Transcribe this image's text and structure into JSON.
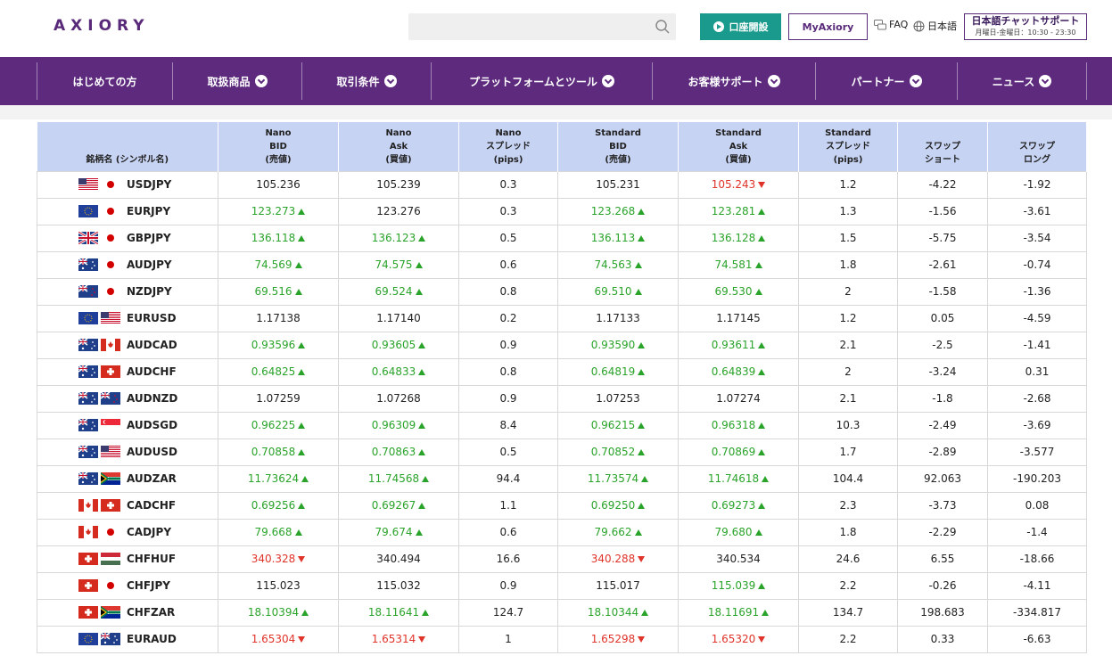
{
  "header": {
    "logo": "AXIORY",
    "search_placeholder": "",
    "open_account_label": "口座開設",
    "myaxiory_label": "MyAxiory",
    "faq_label": "FAQ",
    "language_label": "日本語",
    "chat_title": "日本語チャットサポート",
    "chat_hours": "月曜日-金曜日：10:30 - 23:30"
  },
  "nav": [
    {
      "label": "はじめての方",
      "dropdown": false
    },
    {
      "label": "取扱商品",
      "dropdown": true
    },
    {
      "label": "取引条件",
      "dropdown": true
    },
    {
      "label": "プラットフォームとツール",
      "dropdown": true
    },
    {
      "label": "お客様サポート",
      "dropdown": true
    },
    {
      "label": "パートナー",
      "dropdown": true
    },
    {
      "label": "ニュース",
      "dropdown": true
    }
  ],
  "table": {
    "headers": [
      [
        "銘柄名 (シンボル名)"
      ],
      [
        "Nano",
        "BID",
        "(売値)"
      ],
      [
        "Nano",
        "Ask",
        "(買値)"
      ],
      [
        "Nano",
        "スプレッド",
        "(pips)"
      ],
      [
        "Standard",
        "BID",
        "(売値)"
      ],
      [
        "Standard",
        "Ask",
        "(買値)"
      ],
      [
        "Standard",
        "スプレッド",
        "(pips)"
      ],
      [
        "スワップ",
        "ショート"
      ],
      [
        "スワップ",
        "ロング"
      ]
    ],
    "colors": {
      "up": "#2aa32a",
      "down": "#e0332a"
    },
    "rows": [
      {
        "symbol": "USDJPY",
        "flags": [
          "us",
          "jp"
        ],
        "nbid": "105.236",
        "nbid_dir": "",
        "nask": "105.239",
        "nask_dir": "",
        "nsp": "0.3",
        "sbid": "105.231",
        "sbid_dir": "",
        "sask": "105.243",
        "sask_dir": "down",
        "ssp": "1.2",
        "short": "-4.22",
        "long": "-1.92"
      },
      {
        "symbol": "EURJPY",
        "flags": [
          "eu",
          "jp"
        ],
        "nbid": "123.273",
        "nbid_dir": "up",
        "nask": "123.276",
        "nask_dir": "",
        "nsp": "0.3",
        "sbid": "123.268",
        "sbid_dir": "up",
        "sask": "123.281",
        "sask_dir": "up",
        "ssp": "1.3",
        "short": "-1.56",
        "long": "-3.61"
      },
      {
        "symbol": "GBPJPY",
        "flags": [
          "gb",
          "jp"
        ],
        "nbid": "136.118",
        "nbid_dir": "up",
        "nask": "136.123",
        "nask_dir": "up",
        "nsp": "0.5",
        "sbid": "136.113",
        "sbid_dir": "up",
        "sask": "136.128",
        "sask_dir": "up",
        "ssp": "1.5",
        "short": "-5.75",
        "long": "-3.54"
      },
      {
        "symbol": "AUDJPY",
        "flags": [
          "au",
          "jp"
        ],
        "nbid": "74.569",
        "nbid_dir": "up",
        "nask": "74.575",
        "nask_dir": "up",
        "nsp": "0.6",
        "sbid": "74.563",
        "sbid_dir": "up",
        "sask": "74.581",
        "sask_dir": "up",
        "ssp": "1.8",
        "short": "-2.61",
        "long": "-0.74"
      },
      {
        "symbol": "NZDJPY",
        "flags": [
          "nz",
          "jp"
        ],
        "nbid": "69.516",
        "nbid_dir": "up",
        "nask": "69.524",
        "nask_dir": "up",
        "nsp": "0.8",
        "sbid": "69.510",
        "sbid_dir": "up",
        "sask": "69.530",
        "sask_dir": "up",
        "ssp": "2",
        "short": "-1.58",
        "long": "-1.36"
      },
      {
        "symbol": "EURUSD",
        "flags": [
          "eu",
          "us"
        ],
        "nbid": "1.17138",
        "nbid_dir": "",
        "nask": "1.17140",
        "nask_dir": "",
        "nsp": "0.2",
        "sbid": "1.17133",
        "sbid_dir": "",
        "sask": "1.17145",
        "sask_dir": "",
        "ssp": "1.2",
        "short": "0.05",
        "long": "-4.59"
      },
      {
        "symbol": "AUDCAD",
        "flags": [
          "au",
          "ca"
        ],
        "nbid": "0.93596",
        "nbid_dir": "up",
        "nask": "0.93605",
        "nask_dir": "up",
        "nsp": "0.9",
        "sbid": "0.93590",
        "sbid_dir": "up",
        "sask": "0.93611",
        "sask_dir": "up",
        "ssp": "2.1",
        "short": "-2.5",
        "long": "-1.41"
      },
      {
        "symbol": "AUDCHF",
        "flags": [
          "au",
          "ch"
        ],
        "nbid": "0.64825",
        "nbid_dir": "up",
        "nask": "0.64833",
        "nask_dir": "up",
        "nsp": "0.8",
        "sbid": "0.64819",
        "sbid_dir": "up",
        "sask": "0.64839",
        "sask_dir": "up",
        "ssp": "2",
        "short": "-3.24",
        "long": "0.31"
      },
      {
        "symbol": "AUDNZD",
        "flags": [
          "au",
          "nz"
        ],
        "nbid": "1.07259",
        "nbid_dir": "",
        "nask": "1.07268",
        "nask_dir": "",
        "nsp": "0.9",
        "sbid": "1.07253",
        "sbid_dir": "",
        "sask": "1.07274",
        "sask_dir": "",
        "ssp": "2.1",
        "short": "-1.8",
        "long": "-2.68"
      },
      {
        "symbol": "AUDSGD",
        "flags": [
          "au",
          "sg"
        ],
        "nbid": "0.96225",
        "nbid_dir": "up",
        "nask": "0.96309",
        "nask_dir": "up",
        "nsp": "8.4",
        "sbid": "0.96215",
        "sbid_dir": "up",
        "sask": "0.96318",
        "sask_dir": "up",
        "ssp": "10.3",
        "short": "-2.49",
        "long": "-3.69"
      },
      {
        "symbol": "AUDUSD",
        "flags": [
          "au",
          "us"
        ],
        "nbid": "0.70858",
        "nbid_dir": "up",
        "nask": "0.70863",
        "nask_dir": "up",
        "nsp": "0.5",
        "sbid": "0.70852",
        "sbid_dir": "up",
        "sask": "0.70869",
        "sask_dir": "up",
        "ssp": "1.7",
        "short": "-2.89",
        "long": "-3.577"
      },
      {
        "symbol": "AUDZAR",
        "flags": [
          "au",
          "za"
        ],
        "nbid": "11.73624",
        "nbid_dir": "up",
        "nask": "11.74568",
        "nask_dir": "up",
        "nsp": "94.4",
        "sbid": "11.73574",
        "sbid_dir": "up",
        "sask": "11.74618",
        "sask_dir": "up",
        "ssp": "104.4",
        "short": "92.063",
        "long": "-190.203"
      },
      {
        "symbol": "CADCHF",
        "flags": [
          "ca",
          "ch"
        ],
        "nbid": "0.69256",
        "nbid_dir": "up",
        "nask": "0.69267",
        "nask_dir": "up",
        "nsp": "1.1",
        "sbid": "0.69250",
        "sbid_dir": "up",
        "sask": "0.69273",
        "sask_dir": "up",
        "ssp": "2.3",
        "short": "-3.73",
        "long": "0.08"
      },
      {
        "symbol": "CADJPY",
        "flags": [
          "ca",
          "jp"
        ],
        "nbid": "79.668",
        "nbid_dir": "up",
        "nask": "79.674",
        "nask_dir": "up",
        "nsp": "0.6",
        "sbid": "79.662",
        "sbid_dir": "up",
        "sask": "79.680",
        "sask_dir": "up",
        "ssp": "1.8",
        "short": "-2.29",
        "long": "-1.4"
      },
      {
        "symbol": "CHFHUF",
        "flags": [
          "ch",
          "hu"
        ],
        "nbid": "340.328",
        "nbid_dir": "down",
        "nask": "340.494",
        "nask_dir": "",
        "nsp": "16.6",
        "sbid": "340.288",
        "sbid_dir": "down",
        "sask": "340.534",
        "sask_dir": "",
        "ssp": "24.6",
        "short": "6.55",
        "long": "-18.66"
      },
      {
        "symbol": "CHFJPY",
        "flags": [
          "ch",
          "jp"
        ],
        "nbid": "115.023",
        "nbid_dir": "",
        "nask": "115.032",
        "nask_dir": "",
        "nsp": "0.9",
        "sbid": "115.017",
        "sbid_dir": "",
        "sask": "115.039",
        "sask_dir": "up",
        "ssp": "2.2",
        "short": "-0.26",
        "long": "-4.11"
      },
      {
        "symbol": "CHFZAR",
        "flags": [
          "ch",
          "za"
        ],
        "nbid": "18.10394",
        "nbid_dir": "up",
        "nask": "18.11641",
        "nask_dir": "up",
        "nsp": "124.7",
        "sbid": "18.10344",
        "sbid_dir": "up",
        "sask": "18.11691",
        "sask_dir": "up",
        "ssp": "134.7",
        "short": "198.683",
        "long": "-334.817"
      },
      {
        "symbol": "EURAUD",
        "flags": [
          "eu",
          "au"
        ],
        "nbid": "1.65304",
        "nbid_dir": "down",
        "nask": "1.65314",
        "nask_dir": "down",
        "nsp": "1",
        "sbid": "1.65298",
        "sbid_dir": "down",
        "sask": "1.65320",
        "sask_dir": "down",
        "ssp": "2.2",
        "short": "0.33",
        "long": "-6.63"
      }
    ]
  }
}
